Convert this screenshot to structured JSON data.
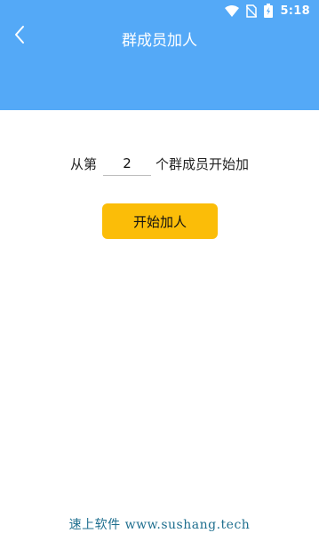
{
  "status_bar": {
    "time": "5:18",
    "icons": [
      "wifi-icon",
      "no-sim-icon",
      "battery-charging-icon"
    ]
  },
  "header": {
    "title": "群成员加人",
    "back_icon": "back-chevron-icon",
    "color": "#54a9f7"
  },
  "form": {
    "prefix": "从第",
    "start_value": "2",
    "suffix": "个群成员开始加"
  },
  "action": {
    "start_label": "开始加人",
    "color": "#fbbd08"
  },
  "watermark": {
    "text": "速上软件 www.sushang.tech"
  }
}
